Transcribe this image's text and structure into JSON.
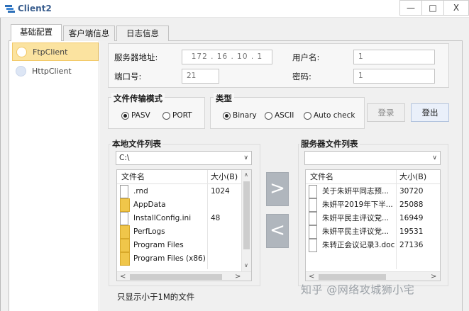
{
  "window": {
    "title": "Client2",
    "controls": {
      "minimize": "—",
      "maximize": "□",
      "close": "X"
    }
  },
  "tabs": [
    {
      "label": "基础配置"
    },
    {
      "label": "客户端信息"
    },
    {
      "label": "日志信息"
    }
  ],
  "client_list": [
    {
      "label": "FtpClient",
      "selected": true
    },
    {
      "label": "HttpClient",
      "selected": false
    }
  ],
  "server": {
    "address_label": "服务器地址:",
    "address_value": "172 . 16 . 10 . 1",
    "port_label": "端口号:",
    "port_value": "21",
    "user_label": "用户名:",
    "user_value": "1",
    "password_label": "密码:",
    "password_value": "1"
  },
  "transfer_mode": {
    "title": "文件传输模式",
    "options": [
      {
        "label": "PASV",
        "checked": true
      },
      {
        "label": "PORT",
        "checked": false
      }
    ]
  },
  "type": {
    "title": "类型",
    "options": [
      {
        "label": "Binary",
        "checked": true
      },
      {
        "label": "ASCII",
        "checked": false
      },
      {
        "label": "Auto check",
        "checked": false
      }
    ]
  },
  "buttons": {
    "login": "登录",
    "logout": "登出"
  },
  "local": {
    "title": "本地文件列表",
    "path": "C:\\",
    "col_name": "文件名",
    "col_size": "大小(B)",
    "rows": [
      {
        "name": ".rnd",
        "size": "1024",
        "kind": "file"
      },
      {
        "name": "AppData",
        "size": "",
        "kind": "folder"
      },
      {
        "name": "InstallConfig.ini",
        "size": "48",
        "kind": "file"
      },
      {
        "name": "PerfLogs",
        "size": "",
        "kind": "folder"
      },
      {
        "name": "Program Files",
        "size": "",
        "kind": "folder"
      },
      {
        "name": "Program Files (x86)",
        "size": "",
        "kind": "folder"
      }
    ]
  },
  "remote": {
    "title": "服务器文件列表",
    "path": "",
    "col_name": "文件名",
    "col_size": "大小(B)",
    "rows": [
      {
        "name": "关于朱妍平同志预...",
        "size": "30720",
        "kind": "file"
      },
      {
        "name": "朱妍平2019年下半...",
        "size": "25088",
        "kind": "file"
      },
      {
        "name": "朱妍平民主评议党...",
        "size": "16949",
        "kind": "file"
      },
      {
        "name": "朱妍平民主评议党...",
        "size": "19531",
        "kind": "file"
      },
      {
        "name": "朱转正会议记录3.doc",
        "size": "27136",
        "kind": "file"
      }
    ]
  },
  "transfer_buttons": {
    "upload": ">",
    "download": "<"
  },
  "filter_note": "只显示小于1M的文件",
  "watermark": "知乎 @网络攻城狮小宅"
}
